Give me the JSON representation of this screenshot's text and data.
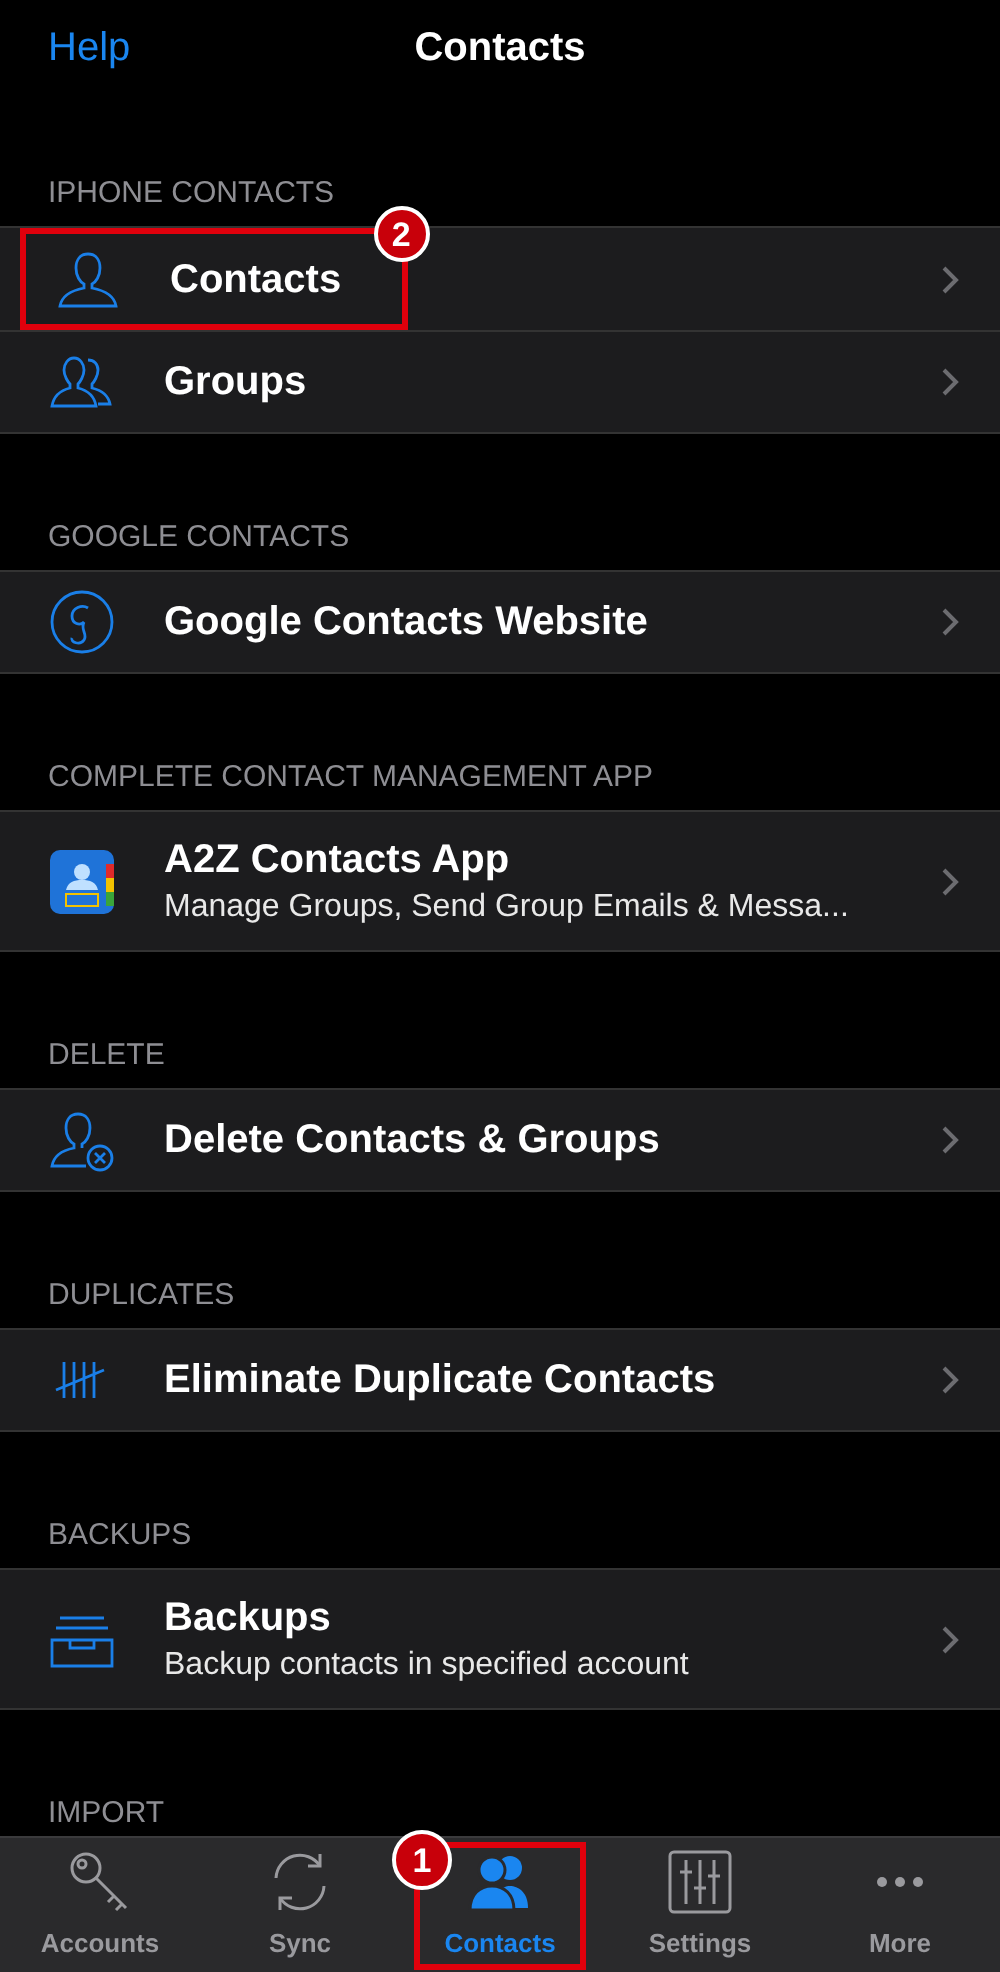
{
  "nav": {
    "back": "Help",
    "title": "Contacts"
  },
  "sections": [
    {
      "header": "IPHONE CONTACTS",
      "rows": [
        {
          "kind": "person",
          "title": "Contacts",
          "highlighted": true,
          "badge": "2"
        },
        {
          "kind": "group",
          "title": "Groups",
          "highlighted": false
        }
      ]
    },
    {
      "header": "GOOGLE CONTACTS",
      "rows": [
        {
          "kind": "google",
          "title": "Google Contacts Website",
          "highlighted": false
        }
      ]
    },
    {
      "header": "COMPLETE CONTACT MANAGEMENT APP",
      "rows": [
        {
          "kind": "app",
          "title": "A2Z Contacts App",
          "subtitle": "Manage Groups, Send Group Emails & Messa...",
          "highlighted": false
        }
      ]
    },
    {
      "header": "DELETE",
      "rows": [
        {
          "kind": "delete",
          "title": "Delete Contacts & Groups",
          "highlighted": false
        }
      ]
    },
    {
      "header": "DUPLICATES",
      "rows": [
        {
          "kind": "tally",
          "title": "Eliminate Duplicate Contacts",
          "highlighted": false
        }
      ]
    },
    {
      "header": "BACKUPS",
      "rows": [
        {
          "kind": "tray",
          "title": "Backups",
          "subtitle": "Backup contacts in specified account",
          "highlighted": false
        }
      ]
    },
    {
      "header": "IMPORT"
    }
  ],
  "tabs": [
    {
      "kind": "key",
      "label": "Accounts",
      "selected": false,
      "highlighted": false
    },
    {
      "kind": "sync",
      "label": "Sync",
      "selected": false,
      "highlighted": false
    },
    {
      "kind": "group",
      "label": "Contacts",
      "selected": true,
      "highlighted": true,
      "badge": "1"
    },
    {
      "kind": "sliders",
      "label": "Settings",
      "selected": false,
      "highlighted": false
    },
    {
      "kind": "more",
      "label": "More",
      "selected": false,
      "highlighted": false
    }
  ]
}
